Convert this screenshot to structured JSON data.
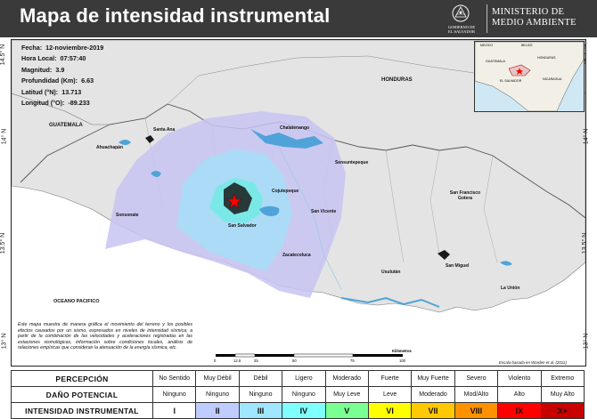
{
  "header": {
    "title": "Mapa de intensidad instrumental",
    "gov_lines": [
      "GOBIERNO DE",
      "EL SALVADOR"
    ],
    "ministry_lines": [
      "MINISTERIO DE",
      "MEDIO AMBIENTE"
    ],
    "header_bg": "#3a3a3a"
  },
  "event": {
    "date_label": "Fecha:",
    "date": "12-noviembre-2019",
    "time_label": "Hora Local:",
    "time": "07:57:40",
    "mag_label": "Magnitud:",
    "mag": "3.9",
    "depth_label": "Profundidad (Km):",
    "depth": "6.63",
    "lat_label": "Latitud (°N):",
    "lat": "13.713",
    "lon_label": "Longitud (°O):",
    "lon": "-89.233"
  },
  "latitude_ticks": {
    "left": [
      "14.5° N",
      "14° N",
      "13.5° N",
      "13° N"
    ],
    "right": [
      "14.5° N",
      "14° N",
      "13.5° N",
      "13° N"
    ]
  },
  "regions": {
    "guatemala": "GUATEMALA",
    "honduras": "HONDURAS",
    "ocean": "OCEANO PACIFICO"
  },
  "places": {
    "santa_ana": "Santa Ana",
    "chalatenango": "Chalatenango",
    "ahuachapan": "Ahuachapán",
    "sensuntepeque": "Sensuntepeque",
    "cojutepeque": "Cojutepeque",
    "san_francisco_gotera": "San Francisco Gotera",
    "sonsonate": "Sonsonate",
    "san_vicente": "San Vicente",
    "san_salvador": "San Salvador",
    "zacatecoluca": "Zacatecoluca",
    "usulutan": "Usulután",
    "san_miguel": "San Miguel",
    "la_union": "La Unión"
  },
  "inset": {
    "labels": [
      "MEXICO",
      "BELICE",
      "GUATEMALA",
      "HONDURAS",
      "EL SALVADOR",
      "NICARAGUA"
    ]
  },
  "description": "Este mapa muestra de manera gráfica el movimiento del terreno y los posibles efectos causados por un sismo, expresados en niveles de intensidad sísmica; a partir de la combinación de las velocidades y aceleraciones registradas en las estaciones sismológicas, información sobre condiciones locales, análisis de relaciones empíricas que consideran la atenuación de la energía sísmica, etc.",
  "scale_bar": {
    "ticks": [
      "0",
      "12.5",
      "25",
      "50",
      "75",
      "100"
    ],
    "unit": "Kilómetros"
  },
  "source": "Escala basada en Worden et al. (2011)",
  "legend": {
    "rows": [
      {
        "header": "PERCEPCIÓN",
        "cells": [
          "No Sentido",
          "Muy Débil",
          "Débil",
          "Ligero",
          "Moderado",
          "Fuerte",
          "Muy Fuerte",
          "Severo",
          "Violento",
          "Extremo"
        ]
      },
      {
        "header": "DAÑO POTENCIAL",
        "cells": [
          "Ninguno",
          "Ninguno",
          "Ninguno",
          "Ninguno",
          "Muy Leve",
          "Leve",
          "Moderado",
          "Mod/Alto",
          "Alto",
          "Muy Alto"
        ]
      },
      {
        "header": "INTENSIDAD INSTRUMENTAL",
        "cells": [
          "I",
          "II",
          "III",
          "IV",
          "V",
          "VI",
          "VII",
          "VIII",
          "IX",
          "X+"
        ]
      }
    ],
    "colors": [
      "#ffffff",
      "#bfccff",
      "#a0e6ff",
      "#80ffff",
      "#7aff93",
      "#ffff00",
      "#ffc800",
      "#ff9100",
      "#ff0000",
      "#c80000"
    ]
  },
  "intensity_colors": {
    "II": "#c8c4f2",
    "III": "#a9dcf5",
    "IV": "#7be8e8",
    "epicenter": "#ff0000",
    "water": "#4fa3d9",
    "land": "#e6e6e6"
  }
}
